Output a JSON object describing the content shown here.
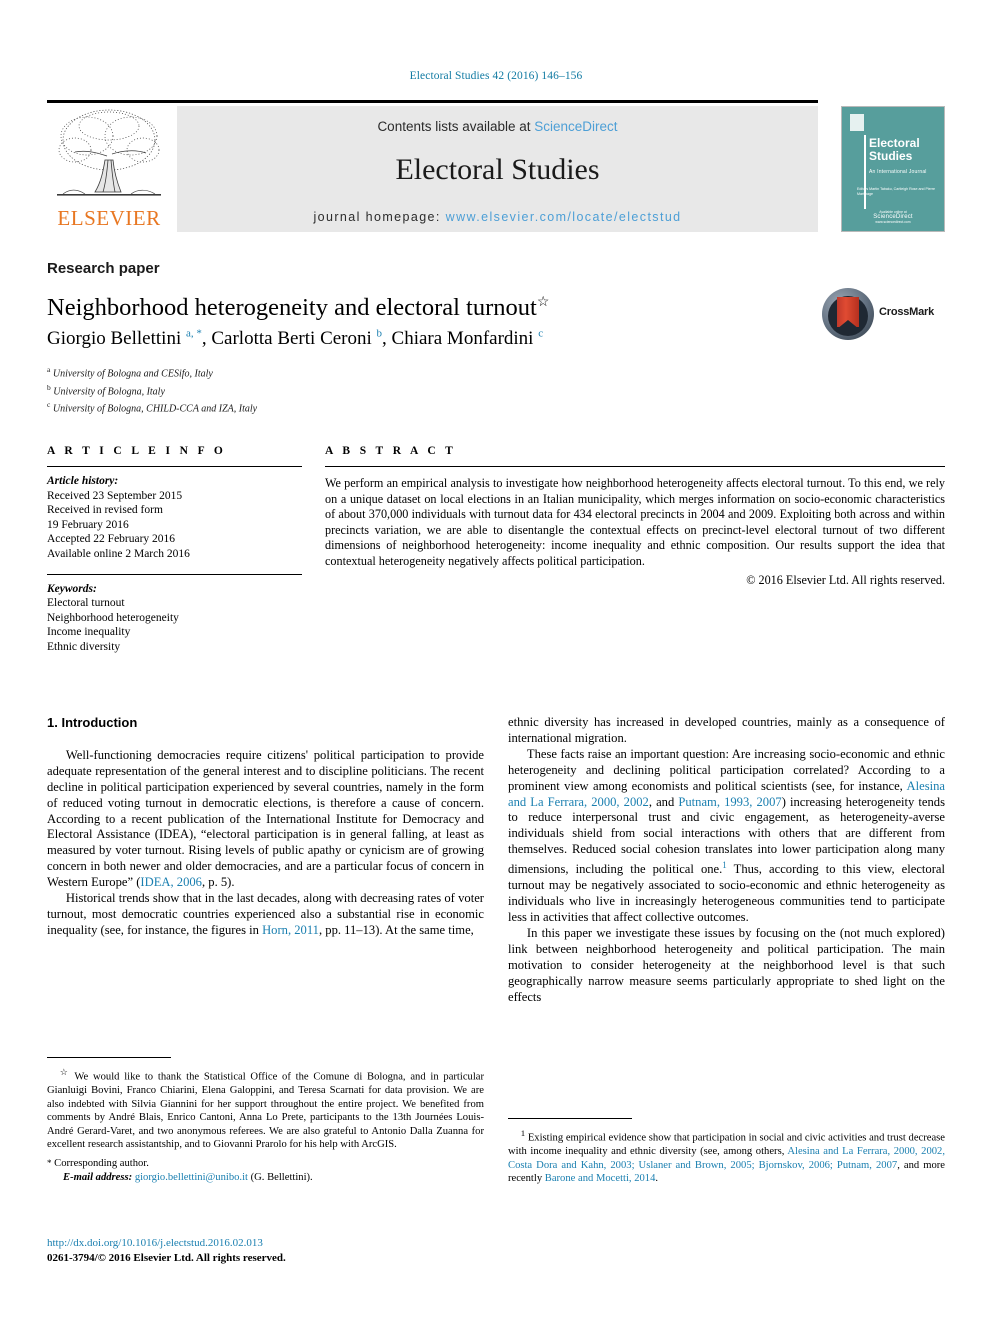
{
  "running_head": "Electoral Studies 42 (2016) 146–156",
  "masthead": {
    "contents_prefix": "Contents lists available at ",
    "contents_link": "ScienceDirect",
    "journal_title": "Electoral Studies",
    "homepage_prefix": "journal homepage:",
    "homepage_link": "www.elsevier.com/locate/electstud",
    "publisher_wordmark": "ELSEVIER",
    "publisher_color": "#e87722",
    "link_color": "#4d9fd6"
  },
  "cover": {
    "title_line1": "Electoral",
    "title_line2": "Studies",
    "subtitle": "An International Journal",
    "editors": "Editors\nMartin Tabaku, Cartleigh Rose and Pierre Martinage",
    "footer_label": "Available online at",
    "footer_brand": "ScienceDirect",
    "footer_sub": "www.sciencedirect.com",
    "background_color": "#579e9c"
  },
  "article": {
    "type": "Research paper",
    "title": "Neighborhood heterogeneity and electoral turnout",
    "title_marker": "☆",
    "authors_html": "Giorgio Bellettini <sup>a, *</sup>, Carlotta Berti Ceroni <sup>b</sup>, Chiara Monfardini <sup>c</sup>",
    "affiliations": [
      {
        "mark": "a",
        "text": "University of Bologna and CESifo, Italy"
      },
      {
        "mark": "b",
        "text": "University of Bologna, Italy"
      },
      {
        "mark": "c",
        "text": "University of Bologna, CHILD-CCA and IZA, Italy"
      }
    ],
    "crossmark_label": "CrossMark"
  },
  "info": {
    "heading": "A R T I C L E   I N F O",
    "history_label": "Article history:",
    "history": [
      "Received 23 September 2015",
      "Received in revised form",
      "19 February 2016",
      "Accepted 22 February 2016",
      "Available online 2 March 2016"
    ],
    "keywords_label": "Keywords:",
    "keywords": [
      "Electoral turnout",
      "Neighborhood heterogeneity",
      "Income inequality",
      "Ethnic diversity"
    ]
  },
  "abstract": {
    "heading": "A B S T R A C T",
    "text": "We perform an empirical analysis to investigate how neighborhood heterogeneity affects electoral turnout. To this end, we rely on a unique dataset on local elections in an Italian municipality, which merges information on socio-economic characteristics of about 370,000 individuals with turnout data for 434 electoral precincts in 2004 and 2009. Exploiting both across and within precincts variation, we are able to disentangle the contextual effects on precinct-level electoral turnout of two different dimensions of neighborhood heterogeneity: income inequality and ethnic composition. Our results support the idea that contextual heterogeneity negatively affects political participation.",
    "copyright": "© 2016 Elsevier Ltd. All rights reserved."
  },
  "body": {
    "section_number_title": "1. Introduction",
    "left_paragraphs": [
      "Well-functioning democracies require citizens' political participation to provide adequate representation of the general interest and to discipline politicians. The recent decline in political participation experienced by several countries, namely in the form of reduced voting turnout in democratic elections, is therefore a cause of concern. According to a recent publication of the International Institute for Democracy and Electoral Assistance (IDEA), “electoral participation is in general falling, at least as measured by voter turnout. Rising levels of public apathy or cynicism are of growing concern in both newer and older democracies, and are a particular focus of concern in Western Europe” (",
      "Historical trends show that in the last decades, along with decreasing rates of voter turnout, most democratic countries experienced also a substantial rise in economic inequality (see, for instance, the figures in "
    ],
    "left_refs": {
      "idea": "IDEA, 2006",
      "idea_tail": ", p. 5).",
      "horn": "Horn, 2011",
      "horn_tail": ", pp. 11–13). At the same time,"
    },
    "right_paragraphs": {
      "p1": "ethnic diversity has increased in developed countries, mainly as a consequence of international migration.",
      "p2_a": "These facts raise an important question: Are increasing socio-economic and ethnic heterogeneity and declining political participation correlated? According to a prominent view among economists and political scientists (see, for instance, ",
      "p2_ref1": "Alesina and La Ferrara, 2000, 2002",
      "p2_b": ", and ",
      "p2_ref2": "Putnam, 1993, 2007",
      "p2_c": ") increasing heterogeneity tends to reduce interpersonal trust and civic engagement, as heterogeneity-averse individuals shield from social interactions with others that are different from themselves. Reduced social cohesion translates into lower participation along many dimensions, including the political one.",
      "p2_fn": "1",
      "p2_d": " Thus, according to this view, electoral turnout may be negatively associated to socio-economic and ethnic heterogeneity as individuals who live in increasingly heterogeneous communities tend to participate less in activities that affect collective outcomes.",
      "p3": "In this paper we investigate these issues by focusing on the (not much explored) link between neighborhood heterogeneity and political participation. The main motivation to consider heterogeneity at the neighborhood level is that such geographically narrow measure seems particularly appropriate to shed light on the effects"
    },
    "italic_term": "neighborhood"
  },
  "footnotes": {
    "left_star": "☆",
    "left_text": "We would like to thank the Statistical Office of the Comune di Bologna, and in particular Gianluigi Bovini, Franco Chiarini, Elena Galoppini, and Teresa Scarnati for data provision. We are also indebted with Silvia Giannini for her support throughout the entire project. We benefited from comments by André Blais, Enrico Cantoni, Anna Lo Prete, participants to the 13th Journées Louis-André Gerard-Varet, and two anonymous referees. We are also grateful to Antonio Dalla Zuanna for excellent research assistantship, and to Giovanni Prarolo for his help with ArcGIS.",
    "corresponding": "Corresponding author.",
    "email_label": "E-mail address:",
    "email": "giorgio.bellettini@unibo.it",
    "email_owner": "(G. Bellettini).",
    "doi": "http://dx.doi.org/10.1016/j.electstud.2016.02.013",
    "issn_line": "0261-3794/© 2016 Elsevier Ltd. All rights reserved.",
    "right_marker": "1",
    "right_a": "Existing empirical evidence show that participation in social and civic activities and trust decrease with income inequality and ethnic diversity (see, among others, ",
    "right_ref1": "Alesina and La Ferrara, 2000, 2002, Costa Dora and Kahn, 2003; Uslaner and Brown, 2005; Bjornskov, 2006; Putnam, 2007",
    "right_b": ", and more recently ",
    "right_ref2": "Barone and Mocetti, 2014",
    "right_c": "."
  }
}
